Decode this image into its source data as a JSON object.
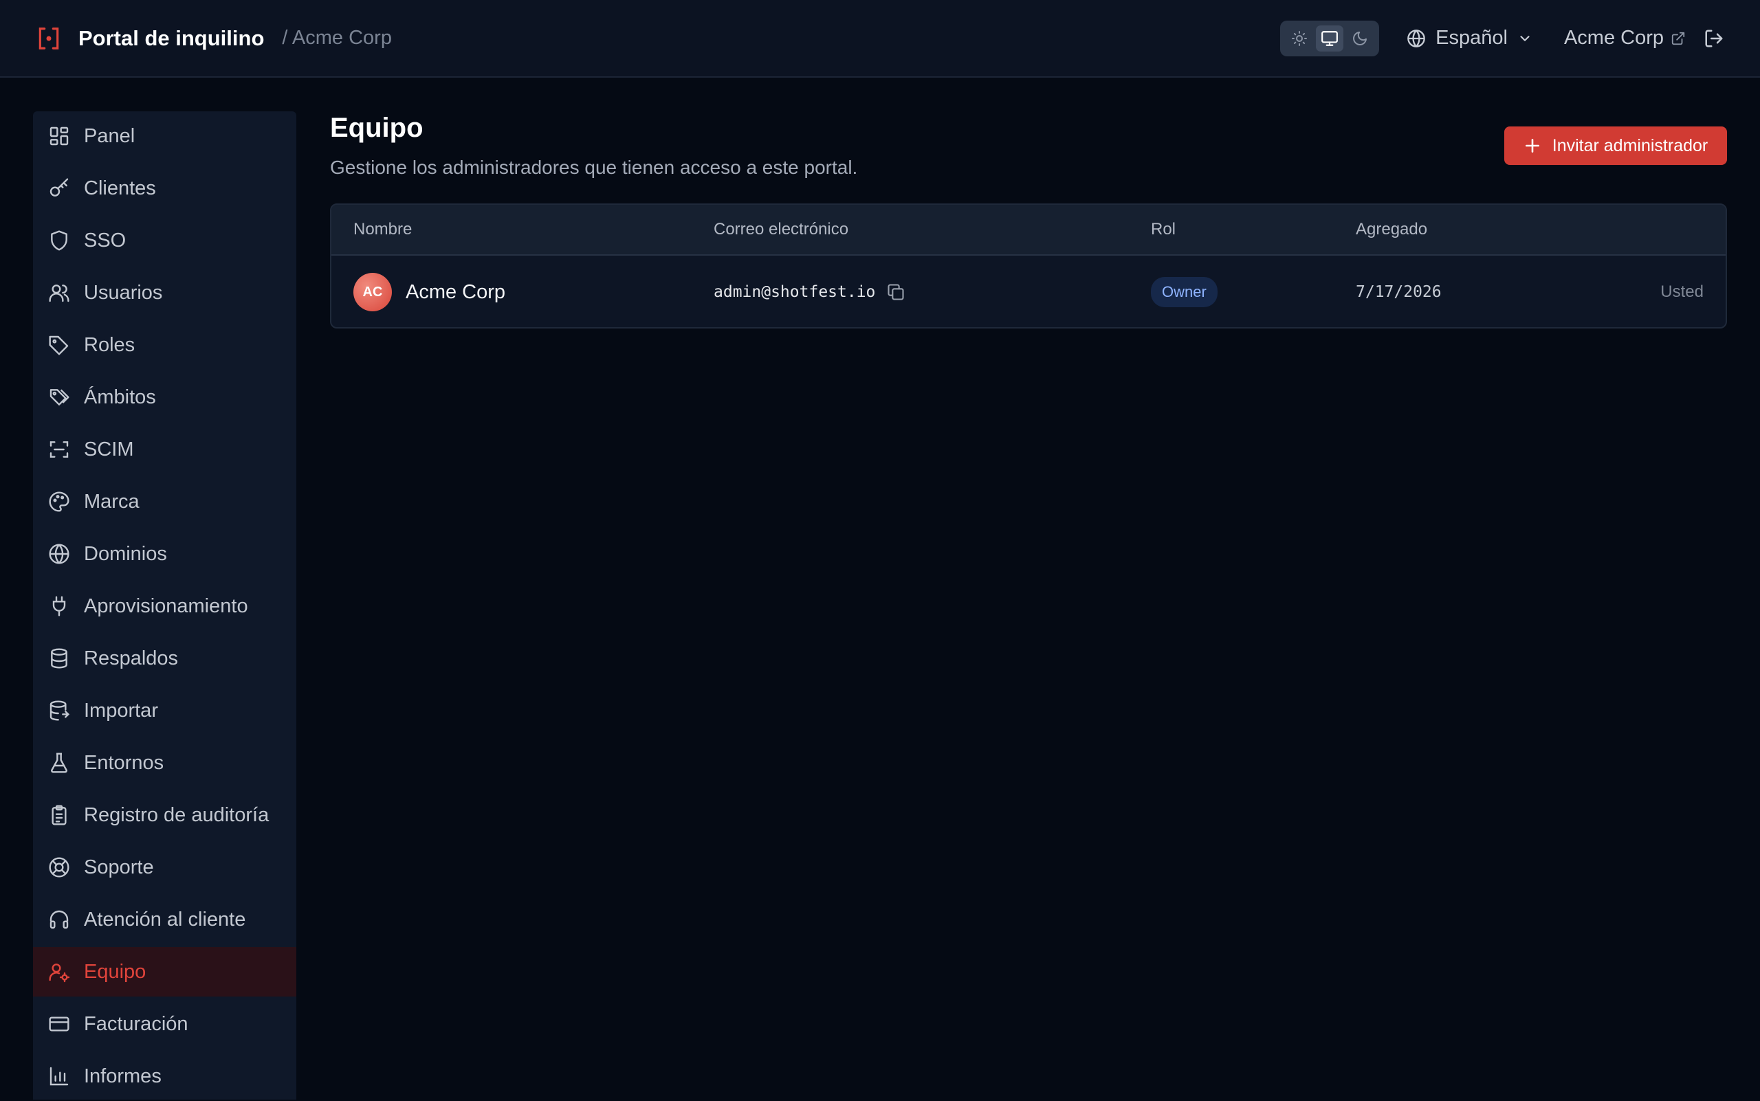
{
  "header": {
    "title": "Portal de inquilino",
    "breadcrumb": "/ Acme Corp",
    "language": "Español",
    "tenant_link": "Acme Corp",
    "brand_color": "#e0443b"
  },
  "sidebar": {
    "items": [
      {
        "label": "Panel",
        "icon": "dashboard-icon"
      },
      {
        "label": "Clientes",
        "icon": "key-icon"
      },
      {
        "label": "SSO",
        "icon": "shield-icon"
      },
      {
        "label": "Usuarios",
        "icon": "users-icon"
      },
      {
        "label": "Roles",
        "icon": "tag-icon"
      },
      {
        "label": "Ámbitos",
        "icon": "tags-icon"
      },
      {
        "label": "SCIM",
        "icon": "scan-icon"
      },
      {
        "label": "Marca",
        "icon": "palette-icon"
      },
      {
        "label": "Dominios",
        "icon": "globe-icon"
      },
      {
        "label": "Aprovisionamiento",
        "icon": "plug-icon"
      },
      {
        "label": "Respaldos",
        "icon": "database-icon"
      },
      {
        "label": "Importar",
        "icon": "database-import-icon"
      },
      {
        "label": "Entornos",
        "icon": "flask-icon"
      },
      {
        "label": "Registro de auditoría",
        "icon": "clipboard-icon"
      },
      {
        "label": "Soporte",
        "icon": "lifebuoy-icon"
      },
      {
        "label": "Atención al cliente",
        "icon": "headset-icon"
      },
      {
        "label": "Equipo",
        "icon": "user-cog-icon",
        "active": true
      },
      {
        "label": "Facturación",
        "icon": "credit-card-icon"
      },
      {
        "label": "Informes",
        "icon": "bar-chart-icon"
      }
    ]
  },
  "main": {
    "title": "Equipo",
    "subtitle": "Gestione los administradores que tienen acceso a este portal.",
    "invite_label": "Invitar administrador",
    "table": {
      "columns": [
        "Nombre",
        "Correo electrónico",
        "Rol",
        "Agregado"
      ],
      "rows": [
        {
          "initials": "AC",
          "name": "Acme Corp",
          "email": "admin@shotfest.io",
          "role": "Owner",
          "added": "7/17/2026",
          "note": "Usted"
        }
      ]
    }
  }
}
